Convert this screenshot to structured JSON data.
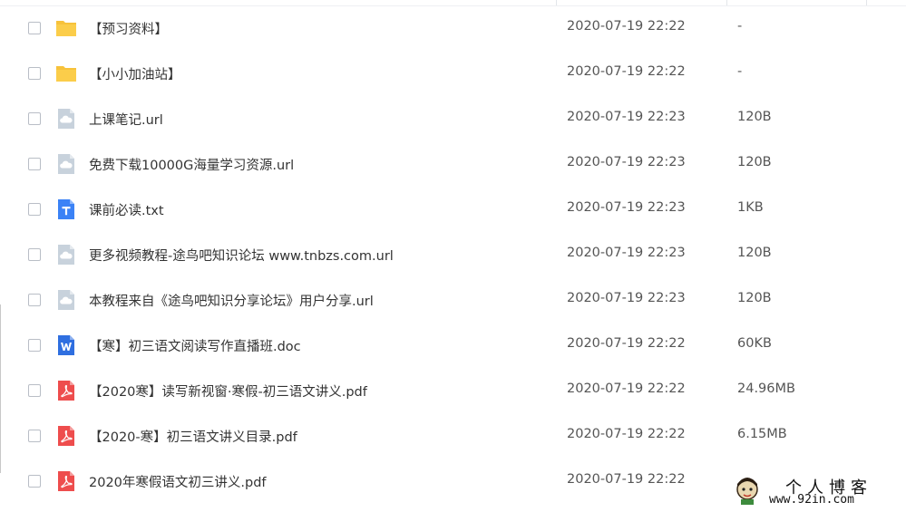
{
  "files": [
    {
      "name": "【预习资料】",
      "time": "2020-07-19 22:22",
      "size": "-",
      "type": "folder"
    },
    {
      "name": "【小小加油站】",
      "time": "2020-07-19 22:22",
      "size": "-",
      "type": "folder"
    },
    {
      "name": "上课笔记.url",
      "time": "2020-07-19 22:23",
      "size": "120B",
      "type": "url"
    },
    {
      "name": "免费下载10000G海量学习资源.url",
      "time": "2020-07-19 22:23",
      "size": "120B",
      "type": "url"
    },
    {
      "name": "课前必读.txt",
      "time": "2020-07-19 22:23",
      "size": "1KB",
      "type": "txt"
    },
    {
      "name": "更多视频教程-途鸟吧知识论坛 www.tnbzs.com.url",
      "time": "2020-07-19 22:23",
      "size": "120B",
      "type": "url"
    },
    {
      "name": "本教程来自《途鸟吧知识分享论坛》用户分享.url",
      "time": "2020-07-19 22:23",
      "size": "120B",
      "type": "url"
    },
    {
      "name": "【寒】初三语文阅读写作直播班.doc",
      "time": "2020-07-19 22:22",
      "size": "60KB",
      "type": "doc"
    },
    {
      "name": "【2020寒】读写新视窗·寒假-初三语文讲义.pdf",
      "time": "2020-07-19 22:22",
      "size": "24.96MB",
      "type": "pdf"
    },
    {
      "name": "【2020-寒】初三语文讲义目录.pdf",
      "time": "2020-07-19 22:22",
      "size": "6.15MB",
      "type": "pdf"
    },
    {
      "name": "2020年寒假语文初三讲义.pdf",
      "time": "2020-07-19 22:22",
      "size": "",
      "type": "pdf"
    }
  ],
  "watermark": {
    "title": "个人博客",
    "url": "www.92in.com"
  },
  "colors": {
    "folder": "#f7c23b",
    "url": "#c8d2dc",
    "txt": "#3b82f6",
    "doc": "#2f6fe0",
    "pdf": "#ee4d4d"
  }
}
